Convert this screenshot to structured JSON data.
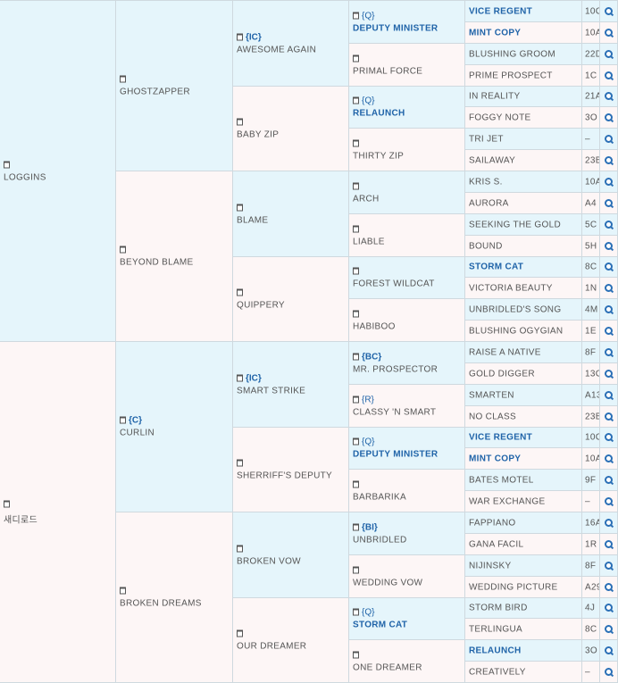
{
  "pedigree": {
    "gen1": [
      {
        "name": "LOGGINS"
      },
      {
        "name": "새디로드"
      }
    ],
    "gen2": [
      {
        "name": "GHOSTZAPPER"
      },
      {
        "name": "BEYOND BLAME"
      },
      {
        "tag": "{C}",
        "name": "CURLIN"
      },
      {
        "name": "BROKEN DREAMS"
      }
    ],
    "gen3": [
      {
        "tag": "{IC}",
        "name": "AWESOME AGAIN"
      },
      {
        "name": "BABY ZIP"
      },
      {
        "name": "BLAME"
      },
      {
        "name": "QUIPPERY"
      },
      {
        "tag": "{IC}",
        "name": "SMART STRIKE"
      },
      {
        "name": "SHERRIFF'S DEPUTY"
      },
      {
        "name": "BROKEN VOW"
      },
      {
        "name": "OUR DREAMER"
      }
    ],
    "gen4": [
      {
        "tag": "{Q}",
        "name": "DEPUTY MINISTER",
        "hl": true
      },
      {
        "name": "PRIMAL FORCE"
      },
      {
        "tag": "{Q}",
        "name": "RELAUNCH",
        "hl": true
      },
      {
        "name": "THIRTY ZIP"
      },
      {
        "name": "ARCH"
      },
      {
        "name": "LIABLE"
      },
      {
        "name": "FOREST WILDCAT"
      },
      {
        "name": "HABIBOO"
      },
      {
        "tag": "{BC}",
        "name": "MR. PROSPECTOR"
      },
      {
        "tag": "{R}",
        "name": "CLASSY 'N SMART"
      },
      {
        "tag": "{Q}",
        "name": "DEPUTY MINISTER",
        "hl": true
      },
      {
        "name": "BARBARIKA"
      },
      {
        "tag": "{BI}",
        "name": "UNBRIDLED"
      },
      {
        "name": "WEDDING VOW"
      },
      {
        "tag": "{Q}",
        "name": "STORM CAT",
        "hl": true
      },
      {
        "name": "ONE DREAMER"
      }
    ],
    "gen5": [
      {
        "name": "VICE REGENT",
        "hl": true,
        "code": "10C"
      },
      {
        "name": "MINT COPY",
        "hl": true,
        "code": "10A"
      },
      {
        "name": "BLUSHING GROOM",
        "code": "22D"
      },
      {
        "name": "PRIME PROSPECT",
        "code": "1C"
      },
      {
        "name": "IN REALITY",
        "code": "21A"
      },
      {
        "name": "FOGGY NOTE",
        "code": "3O"
      },
      {
        "name": "TRI JET",
        "code": "–"
      },
      {
        "name": "SAILAWAY",
        "code": "23B"
      },
      {
        "name": "KRIS S.",
        "code": "10A"
      },
      {
        "name": "AURORA",
        "code": "A4"
      },
      {
        "name": "SEEKING THE GOLD",
        "code": "5C"
      },
      {
        "name": "BOUND",
        "code": "5H"
      },
      {
        "name": "STORM CAT",
        "hl": true,
        "code": "8C"
      },
      {
        "name": "VICTORIA BEAUTY",
        "code": "1N"
      },
      {
        "name": "UNBRIDLED'S SONG",
        "code": "4M"
      },
      {
        "name": "BLUSHING OGYGIAN",
        "code": "1E"
      },
      {
        "name": "RAISE A NATIVE",
        "code": "8F"
      },
      {
        "name": "GOLD DIGGER",
        "code": "13C"
      },
      {
        "name": "SMARTEN",
        "code": "A13"
      },
      {
        "name": "NO CLASS",
        "code": "23B"
      },
      {
        "name": "VICE REGENT",
        "hl": true,
        "code": "10C"
      },
      {
        "name": "MINT COPY",
        "hl": true,
        "code": "10A"
      },
      {
        "name": "BATES MOTEL",
        "code": "9F"
      },
      {
        "name": "WAR EXCHANGE",
        "code": "–"
      },
      {
        "name": "FAPPIANO",
        "code": "16A"
      },
      {
        "name": "GANA FACIL",
        "code": "1R"
      },
      {
        "name": "NIJINSKY",
        "code": "8F"
      },
      {
        "name": "WEDDING PICTURE",
        "code": "A29"
      },
      {
        "name": "STORM BIRD",
        "code": "4J"
      },
      {
        "name": "TERLINGUA",
        "code": "8C"
      },
      {
        "name": "RELAUNCH",
        "hl": true,
        "code": "3O"
      },
      {
        "name": "CREATIVELY",
        "code": "–"
      }
    ]
  }
}
